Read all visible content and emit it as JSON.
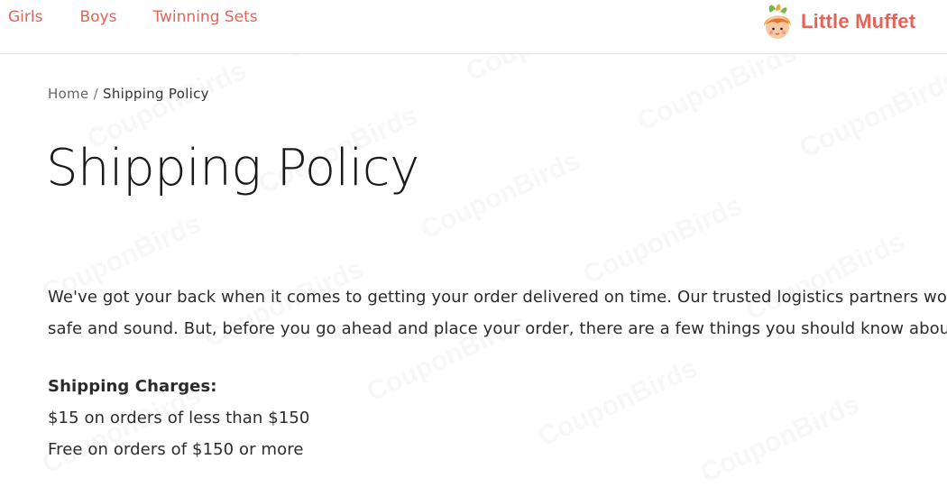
{
  "nav": {
    "items": [
      {
        "label": "Girls"
      },
      {
        "label": "Boys"
      },
      {
        "label": "Twinning Sets"
      }
    ]
  },
  "logo": {
    "text": "Little Muffet",
    "icon": "muffet-girl-logo-icon"
  },
  "breadcrumb": {
    "home": "Home",
    "separator": "/",
    "current": "Shipping Policy"
  },
  "page": {
    "title": "Shipping Policy"
  },
  "content": {
    "intro_line1": "We've got your back when it comes to getting your order delivered on time. Our trusted logistics partners work",
    "intro_line2": "safe and sound. But, before you go ahead and place your order, there are a few things you should know about",
    "charges_heading": "Shipping Charges:",
    "charge_1": "$15 on orders of less than $150",
    "charge_2": "Free on orders of $150 or more"
  },
  "watermark": {
    "text": "CouponBirds"
  },
  "colors": {
    "accent": "#e2645a",
    "text": "#2b2b2b",
    "title": "#1a1a1a"
  }
}
